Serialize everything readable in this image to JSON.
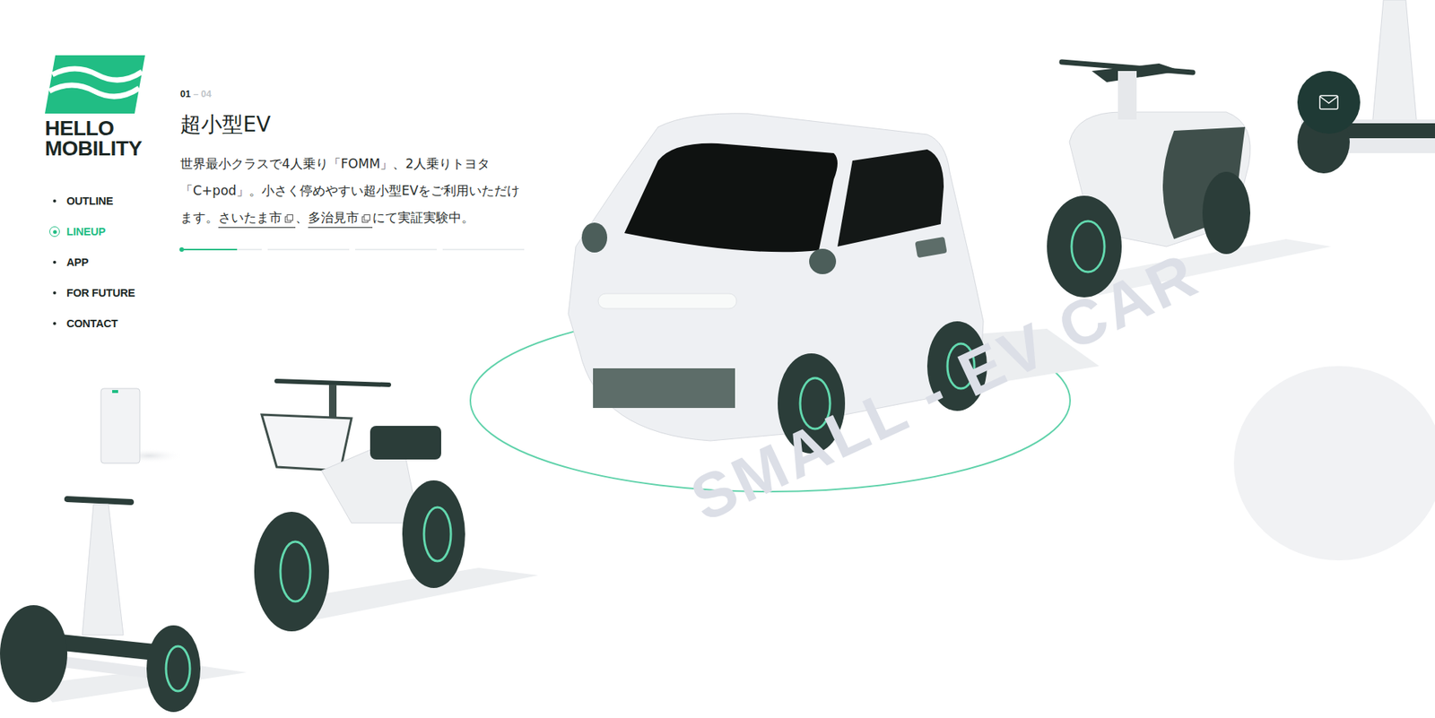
{
  "logo": {
    "lines": [
      "HELLO",
      "MOBILITY"
    ]
  },
  "nav": [
    {
      "label": "OUTLINE",
      "selected": false
    },
    {
      "label": "LINEUP",
      "selected": true
    },
    {
      "label": "APP",
      "selected": false
    },
    {
      "label": "FOR FUTURE",
      "selected": false
    },
    {
      "label": "CONTACT",
      "selected": false
    }
  ],
  "slide": {
    "current": "01",
    "total": "– 04",
    "title": "超小型EV",
    "description": [
      {
        "kind": "text",
        "text": "世界最小クラスで4人乗り「FOMM」、2人乗りトヨタ「C+pod」。小さく停めやすい超小型EVをご利用いただけます。"
      },
      {
        "kind": "link",
        "text": "さいたま市"
      },
      {
        "kind": "text",
        "text": "、"
      },
      {
        "kind": "link",
        "text": "多治見市"
      },
      {
        "kind": "text",
        "text": "にて実証実験中。"
      }
    ],
    "progress": [
      {
        "level": 0.7
      },
      {
        "level": 0
      },
      {
        "level": 0
      },
      {
        "level": 0
      }
    ]
  },
  "scene": {
    "watermark": "SMALL - EV CAR"
  }
}
